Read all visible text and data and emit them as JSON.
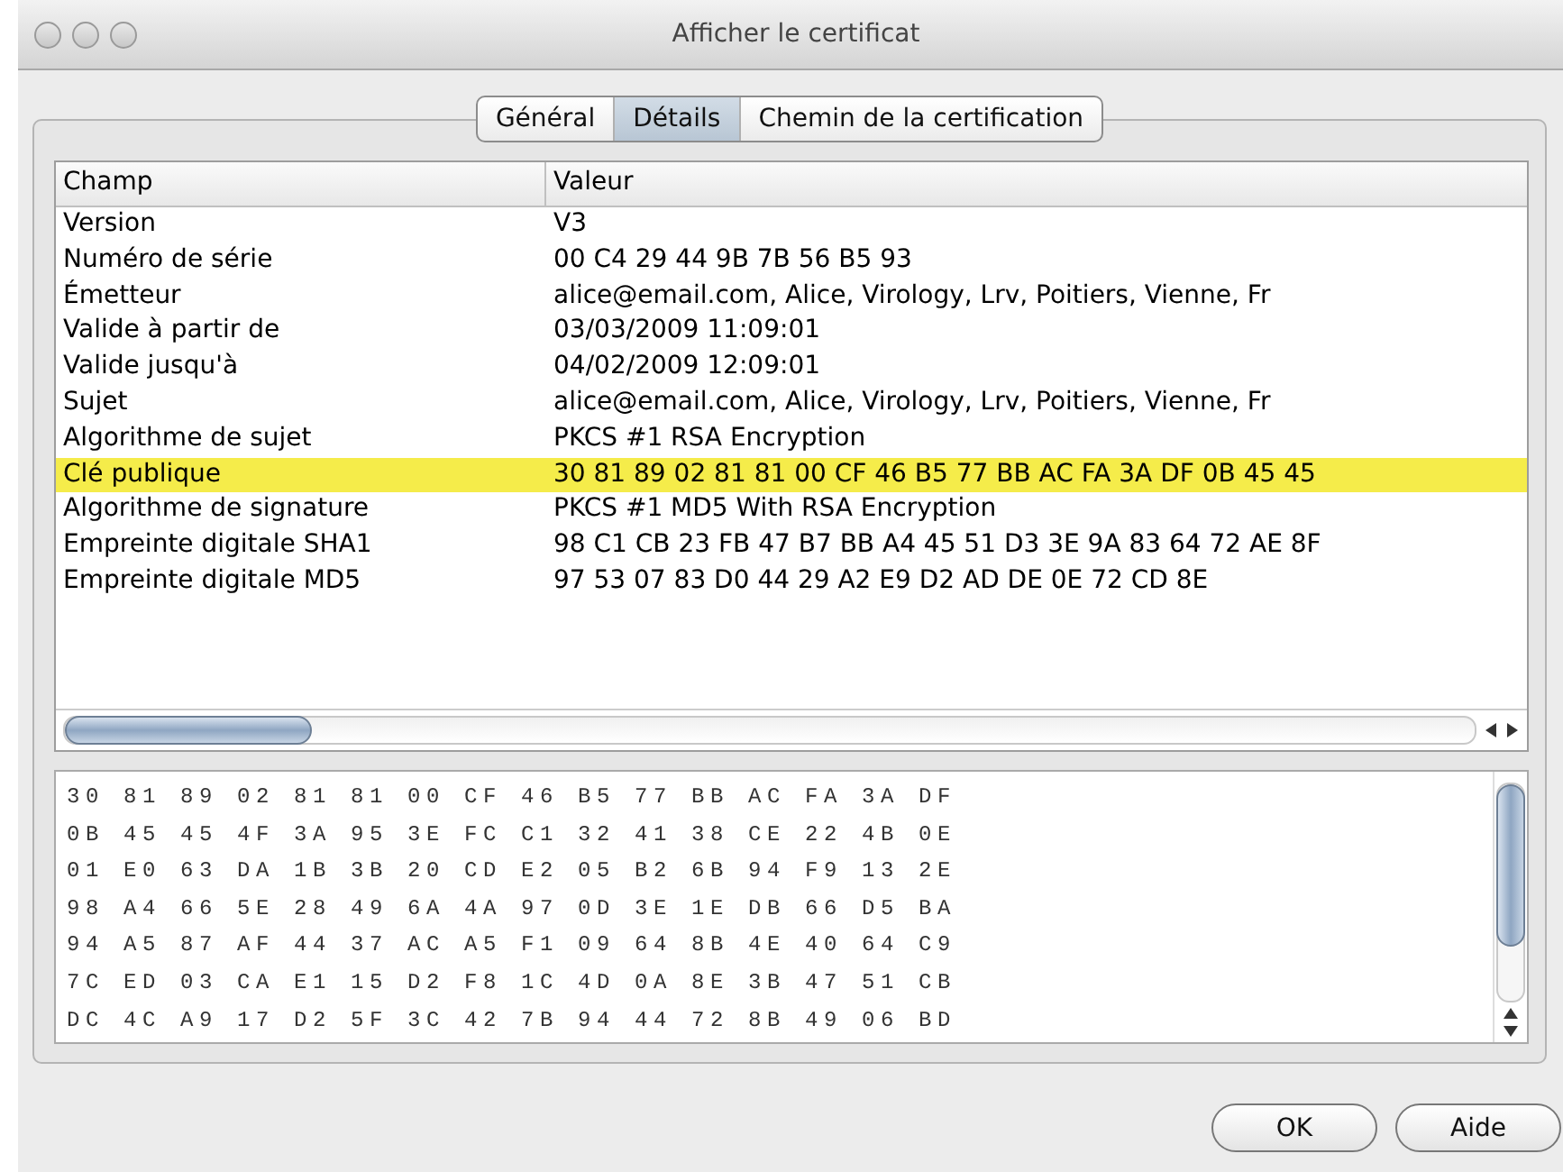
{
  "window": {
    "title": "Afficher le certificat"
  },
  "tabs": [
    {
      "label": "Général",
      "selected": false
    },
    {
      "label": "Détails",
      "selected": true
    },
    {
      "label": "Chemin de la certification",
      "selected": false
    }
  ],
  "table": {
    "columns": [
      "Champ",
      "Valeur"
    ],
    "rows": [
      {
        "field": "Version",
        "value": "V3",
        "selected": false
      },
      {
        "field": "Numéro de série",
        "value": "00 C4 29 44 9B 7B 56 B5 93",
        "selected": false
      },
      {
        "field": "Émetteur",
        "value": "alice@email.com, Alice, Virology, Lrv, Poitiers, Vienne, Fr",
        "selected": false
      },
      {
        "field": "Valide à partir de",
        "value": "03/03/2009 11:09:01",
        "selected": false
      },
      {
        "field": "Valide jusqu'à",
        "value": "04/02/2009 12:09:01",
        "selected": false
      },
      {
        "field": "Sujet",
        "value": "alice@email.com, Alice, Virology, Lrv, Poitiers, Vienne, Fr",
        "selected": false
      },
      {
        "field": "Algorithme de sujet",
        "value": "PKCS #1 RSA Encryption",
        "selected": false
      },
      {
        "field": "Clé publique",
        "value": "30 81 89 02 81 81 00 CF 46 B5 77 BB AC FA 3A DF 0B 45 45",
        "selected": true
      },
      {
        "field": "Algorithme de signature",
        "value": "PKCS #1 MD5 With RSA Encryption",
        "selected": false
      },
      {
        "field": "Empreinte digitale SHA1",
        "value": "98 C1 CB 23 FB 47 B7 BB A4 45 51 D3 3E 9A 83 64 72 AE 8F",
        "selected": false
      },
      {
        "field": "Empreinte digitale MD5",
        "value": "97 53 07 83 D0 44 29 A2 E9 D2 AD DE 0E 72 CD 8E",
        "selected": false
      }
    ]
  },
  "detail_lines": [
    "30 81 89 02 81 81 00 CF 46 B5 77 BB AC FA 3A DF",
    "0B 45 45 4F 3A 95 3E FC C1 32 41 38 CE 22 4B 0E",
    "01 E0 63 DA 1B 3B 20 CD E2 05 B2 6B 94 F9 13 2E",
    "98 A4 66 5E 28 49 6A 4A 97 0D 3E 1E DB 66 D5 BA",
    "94 A5 87 AF 44 37 AC A5 F1 09 64 8B 4E 40 64 C9",
    "7C ED 03 CA E1 15 D2 F8 1C 4D 0A 8E 3B 47 51 CB",
    "DC 4C A9 17 D2 5F 3C 42 7B 94 44 72 8B 49 06 BD"
  ],
  "buttons": [
    "OK",
    "Aide"
  ]
}
